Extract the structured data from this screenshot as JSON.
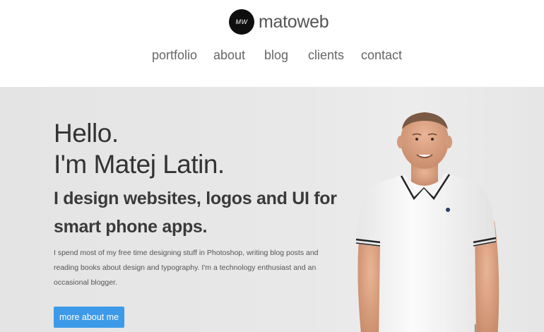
{
  "header": {
    "logo_mark": "MW",
    "logo_text": "matoweb"
  },
  "nav": {
    "items": [
      {
        "label": "portfolio"
      },
      {
        "label": "about"
      },
      {
        "label": "blog"
      },
      {
        "label": "clients"
      },
      {
        "label": "contact"
      }
    ]
  },
  "hero": {
    "hello_line1": "Hello.",
    "hello_line2": "I'm Matej Latin.",
    "tagline": "I design websites, logos and UI for smart phone apps.",
    "bio": "I spend most of my free time designing stuff in Photoshop, writing blog posts and reading books about design and typography. I'm a technology enthusiast and an occasional blogger.",
    "button_label": "more about me",
    "colors": {
      "button": "#3d9ae8",
      "background": "#e8e8e8"
    }
  }
}
